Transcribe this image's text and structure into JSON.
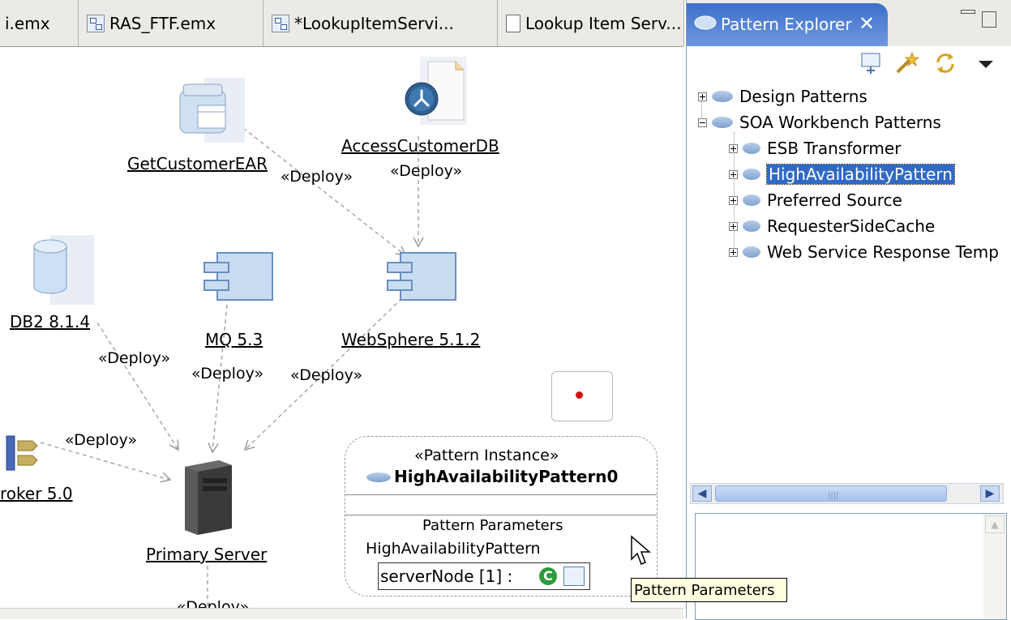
{
  "editor_tabs": [
    {
      "label": "i.emx",
      "icon": "emx-model-icon"
    },
    {
      "label": "RAS_FTF.emx",
      "icon": "emx-model-icon"
    },
    {
      "label": "*LookupItemServi...",
      "icon": "emx-model-icon"
    },
    {
      "label": "Lookup Item Serv...",
      "icon": "document-icon"
    }
  ],
  "diagram": {
    "nodes": {
      "getcustomer": "GetCustomerEAR",
      "accessdb": "AccessCustomerDB",
      "db2": "DB2 8.1.4",
      "mq": "MQ 5.3",
      "websphere": "WebSphere 5.1.2",
      "broker": "roker 5.0",
      "primary": "Primary Server"
    },
    "deploy_label": "«Deploy»"
  },
  "pattern_instance": {
    "stereotype": "«Pattern Instance»",
    "name": "HighAvailabilityPattern0",
    "params_heading": "Pattern Parameters",
    "pattern_name": "HighAvailabilityPattern",
    "param": "serverNode [1] :"
  },
  "tooltip": "Pattern Parameters",
  "panel": {
    "title": "Pattern Explorer",
    "tree": [
      {
        "label": "Design Patterns",
        "expanded": false
      },
      {
        "label": "SOA Workbench Patterns",
        "expanded": true
      },
      {
        "label": "ESB Transformer"
      },
      {
        "label": "HighAvailabilityPattern",
        "selected": true
      },
      {
        "label": "Preferred Source"
      },
      {
        "label": "RequesterSideCache"
      },
      {
        "label": "Web Service Response Temp"
      }
    ]
  },
  "colors": {
    "accent": "#316ac5",
    "panel_tab": "#3d6fc9",
    "tooltip_bg": "#ffffe1"
  }
}
